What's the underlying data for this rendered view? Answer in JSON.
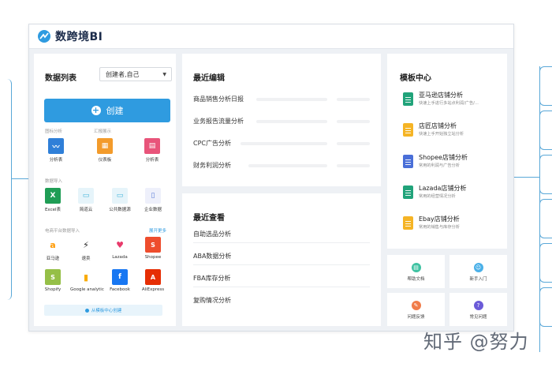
{
  "app": {
    "logo_text": "数跨境BI"
  },
  "data_list": {
    "title": "数据列表",
    "creator_select": "创建者,自己",
    "create_button": "创建",
    "sections": {
      "analysis": "图标分析",
      "summary": "汇报展示",
      "import": "数据导入",
      "ecommerce": "电商平台数据导入",
      "more": "展开更多"
    },
    "analysis_tiles": [
      {
        "label": "分析表",
        "icon": "chart-icon",
        "color": "#2f7fd8"
      },
      {
        "label": "仪表板",
        "icon": "dashboard-icon",
        "color": "#f39b2b"
      },
      {
        "label": "分析表",
        "icon": "grid-chart-icon",
        "color": "#e8547a"
      }
    ],
    "import_tiles": [
      {
        "label": "Excel表",
        "icon": "excel-icon",
        "color": "#1f9d55"
      },
      {
        "label": "简道云",
        "icon": "jiandaoyun-icon",
        "color": "#41b3d9"
      },
      {
        "label": "公共数据源",
        "icon": "public-source-icon",
        "color": "#41b3d9"
      },
      {
        "label": "企业数据",
        "icon": "enterprise-data-icon",
        "color": "#5a7bd8"
      }
    ],
    "ecommerce_tiles": [
      {
        "label": "亚马逊",
        "icon": "amazon-icon",
        "color": "#ff9900"
      },
      {
        "label": "速卖",
        "icon": "speed-icon",
        "color": "#222222"
      },
      {
        "label": "Lazada",
        "icon": "lazada-icon",
        "color": "#e83a6b"
      },
      {
        "label": "Shopee",
        "icon": "shopee-icon",
        "color": "#ee4d2d"
      },
      {
        "label": "Shopify",
        "icon": "shopify-icon",
        "color": "#95bf47"
      },
      {
        "label": "Google analytic",
        "icon": "google-analytics-icon",
        "color": "#f9ab00"
      },
      {
        "label": "Facebook",
        "icon": "facebook-icon",
        "color": "#1877f2"
      },
      {
        "label": "AliExpress",
        "icon": "aliexpress-icon",
        "color": "#e62e04"
      }
    ],
    "from_template": "从模板中心创建"
  },
  "recent_edit": {
    "title": "最近编辑",
    "items": [
      "商品销售分析日报",
      "业务报告流量分析",
      "CPC广告分析",
      "财务利润分析"
    ]
  },
  "recent_view": {
    "title": "最近查看",
    "items": [
      "自助选品分析",
      "ABA数据分析",
      "FBA库存分析",
      "复购情况分析"
    ]
  },
  "template_center": {
    "title": "模板中心",
    "items": [
      {
        "name": "亚马逊店铺分析",
        "desc": "快速上手进行多站点利润/广告/...",
        "color": "#21a37a"
      },
      {
        "name": "店匠店铺分析",
        "desc": "快速上手开始独立站分析",
        "color": "#f5b425"
      },
      {
        "name": "Shopee店铺分析",
        "desc": "常用的利润与广告分析",
        "color": "#4a6fd8"
      },
      {
        "name": "Lazada店铺分析",
        "desc": "常用的经营情况分析",
        "color": "#21a37a"
      },
      {
        "name": "Ebay店铺分析",
        "desc": "常用的销售与库存分析",
        "color": "#f5b425"
      }
    ]
  },
  "shortcuts": [
    {
      "label": "帮助文档",
      "icon": "help-doc-icon",
      "color": "#3fc2a2"
    },
    {
      "label": "新手入门",
      "icon": "beginner-icon",
      "color": "#4ab0e8"
    },
    {
      "label": "问题反馈",
      "icon": "feedback-icon",
      "color": "#f07c4a"
    },
    {
      "label": "常见问题",
      "icon": "faq-icon",
      "color": "#6b5bd8"
    }
  ],
  "watermark": "知乎 @努力"
}
